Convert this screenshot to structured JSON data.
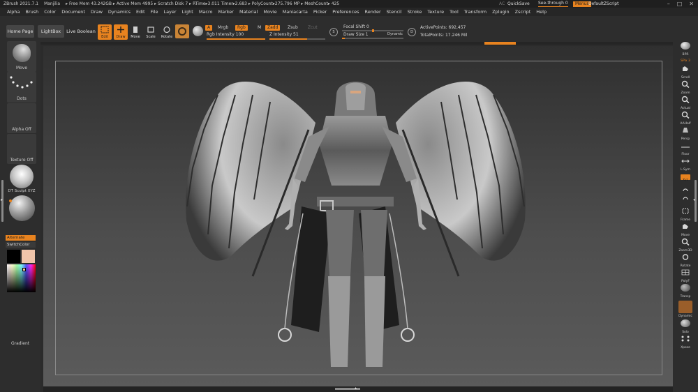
{
  "titlebar": {
    "app": "ZBrush 2021.7.1",
    "project": "Manjilia",
    "stats": "▸ Free Mem 43.242GB ▸ Active Mem 4995 ▸ Scratch Disk 7 ▸  RTime▸3.011 Timer▸2.683 ▸ PolyCount▸275.796 MP  ▸ MeshCount▸ 425",
    "ac": "AC",
    "quicksave": "QuickSave",
    "see_through": "See-through   0",
    "menus": "Menus",
    "script": "DefaultZScript"
  },
  "menubar": [
    "Alpha",
    "Brush",
    "Color",
    "Document",
    "Draw",
    "Dynamics",
    "Edit",
    "File",
    "Layer",
    "Light",
    "Macro",
    "Marker",
    "Material",
    "Movie",
    "Maniacarta",
    "Picker",
    "Preferences",
    "Render",
    "Stencil",
    "Stroke",
    "Texture",
    "Tool",
    "Transform",
    "Zplugin",
    "Zscript",
    "Help"
  ],
  "toolbar": {
    "home_page": "Home Page",
    "lightbox": "LightBox",
    "live_boolean": "Live Boolean",
    "tools": [
      {
        "label": "Edit",
        "active": true
      },
      {
        "label": "Draw",
        "active": true
      },
      {
        "label": "Move",
        "active": false
      },
      {
        "label": "Scale",
        "active": false
      },
      {
        "label": "Rotate",
        "active": false
      }
    ],
    "a_pill": "A",
    "mrgb": "Mrgb",
    "rgb": "Rgb",
    "m": "M",
    "zadd": "Zadd",
    "zsub": "Zsub",
    "zcut": "Zcut",
    "rgb_intensity": "Rgb Intensity 100",
    "rgb_intensity_value": 100,
    "z_intensity": "Z Intensity 51",
    "z_intensity_value": 51,
    "s_label": "S",
    "d_label": "D",
    "focal_shift": "Focal Shift 0",
    "focal_shift_value": 0,
    "draw_size": "Draw Size 1",
    "draw_size_value": 1,
    "dynamic": "Dynamic",
    "active_points": "ActivePoints: 692,457",
    "total_points": "TotalPoints: 17.246 Mil"
  },
  "lefttray": {
    "brush": "Move",
    "stroke": "Dots",
    "alpha": "Alpha Off",
    "texture": "Texture Off",
    "material": "DT Sculpt XYZ",
    "alternate": "Alternate",
    "switchcolor": "SwitchColor",
    "gradient": "Gradient",
    "main_color": "#000000",
    "secondary_color": "#f0c4aa"
  },
  "righttray": [
    {
      "label": "BPR",
      "icon": "bpr-icon"
    },
    {
      "label": "SPix 3",
      "icon": "",
      "on": true
    },
    {
      "label": "Scroll",
      "icon": "scroll-icon"
    },
    {
      "label": "Zoom",
      "icon": "zoom-icon"
    },
    {
      "label": "Actual",
      "icon": "actual-icon"
    },
    {
      "label": "AAHalf",
      "icon": "aahalf-icon"
    },
    {
      "label": "Persp",
      "icon": "persp-icon"
    },
    {
      "label": "Floor",
      "icon": "floor-icon"
    },
    {
      "label": "L.Sym",
      "icon": "lsym-icon"
    },
    {
      "label": "Xyz",
      "icon": "xyz-icon",
      "on": true
    },
    {
      "label": "",
      "icon": "rotate-y-icon"
    },
    {
      "label": "",
      "icon": "rotate-z-icon"
    },
    {
      "label": "Frame",
      "icon": "frame-icon"
    },
    {
      "label": "Move",
      "icon": "move-icon"
    },
    {
      "label": "Zoom3D",
      "icon": "zoom3d-icon"
    },
    {
      "label": "Rotate",
      "icon": "rotate-icon"
    },
    {
      "label": "PolyF",
      "icon": "polyf-icon"
    },
    {
      "label": "Transp",
      "icon": "transp-icon"
    },
    {
      "label": "Dynamic",
      "icon": "ghost-icon"
    },
    {
      "label": "Solo",
      "icon": "solo-icon"
    },
    {
      "label": "Xpose",
      "icon": "xpose-icon"
    }
  ]
}
